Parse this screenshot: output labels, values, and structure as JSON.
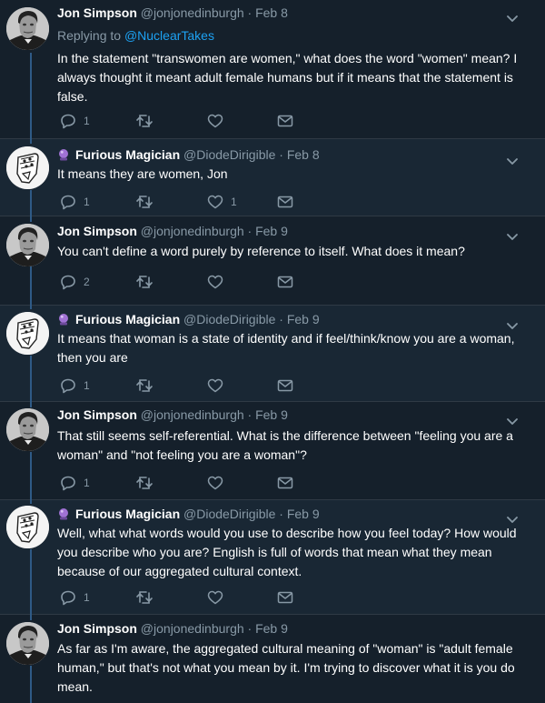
{
  "colors": {
    "background": "#141d26",
    "name_text": "#ffffff",
    "meta_text": "#8899a6",
    "link": "#1da1f2",
    "thread_line": "#2f5a86"
  },
  "tweets": [
    {
      "author": "Jon Simpson",
      "handle": "@jonjonedinburgh",
      "date": "· Feb 8",
      "reply_prefix": "Replying to ",
      "reply_handle": "@NuclearTakes",
      "text": "In the statement \"transwomen are women,\" what does the word \"women\" mean? I always thought it meant adult female humans but if it means that the statement is false.",
      "replies": "1",
      "retweets": "",
      "likes": ""
    },
    {
      "author": "Furious Magician",
      "handle": "@DiodeDirigible",
      "date": "· Feb 8",
      "emoji": "crystal-ball-icon",
      "text": "It means they are women, Jon",
      "replies": "1",
      "retweets": "",
      "likes": "1"
    },
    {
      "author": "Jon Simpson",
      "handle": "@jonjonedinburgh",
      "date": "· Feb 9",
      "text": "You can't define a word purely by reference to itself. What does it mean?",
      "replies": "2",
      "retweets": "",
      "likes": ""
    },
    {
      "author": "Furious Magician",
      "handle": "@DiodeDirigible",
      "date": "· Feb 9",
      "emoji": "crystal-ball-icon",
      "text": "It means that woman is a state of identity and if feel/think/know you are a woman, then you are",
      "replies": "1",
      "retweets": "",
      "likes": ""
    },
    {
      "author": "Jon Simpson",
      "handle": "@jonjonedinburgh",
      "date": "· Feb 9",
      "text": "That still seems self-referential. What is the difference between \"feeling you are a woman\" and \"not feeling you are a woman\"?",
      "replies": "1",
      "retweets": "",
      "likes": ""
    },
    {
      "author": "Furious Magician",
      "handle": "@DiodeDirigible",
      "date": "· Feb 9",
      "emoji": "crystal-ball-icon",
      "text": "Well, what what words would you use to describe how you feel today? How would you describe who you are? English is full of words that mean what they mean because of our aggregated cultural context.",
      "replies": "1",
      "retweets": "",
      "likes": ""
    },
    {
      "author": "Jon Simpson",
      "handle": "@jonjonedinburgh",
      "date": "· Feb 9",
      "text": "As far as I'm aware, the aggregated cultural meaning of \"woman\" is \"adult female human,\"  but that's not what you mean by it.  I'm trying to discover what it is you do mean.",
      "replies": "",
      "retweets": "",
      "likes": ""
    }
  ]
}
